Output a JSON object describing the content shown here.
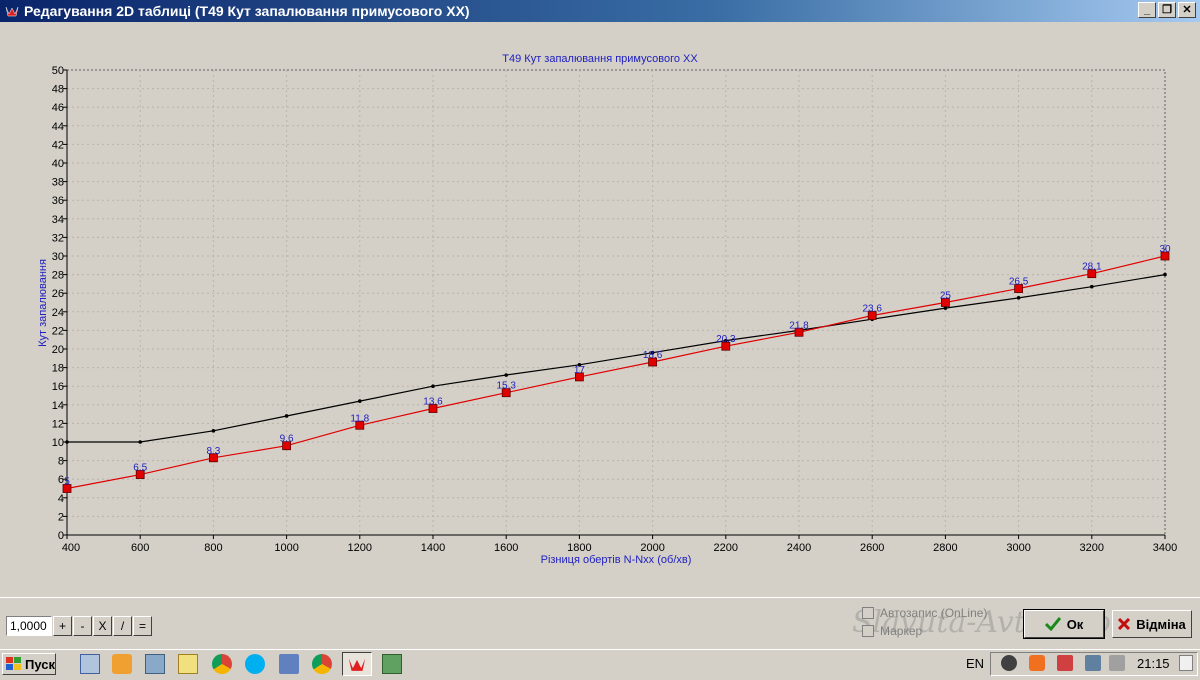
{
  "window": {
    "title": "Редагування 2D таблиці (T49 Кут запалювання примусового XX)",
    "buttons": {
      "minimize": "_",
      "restore": "❐",
      "close": "✕"
    }
  },
  "chart_data": {
    "type": "line",
    "title": "T49 Кут запалювання примусового XX",
    "xlabel": "Різниця обертів N-Nxx (об/хв)",
    "ylabel": "Кут запалювання",
    "x": [
      400,
      600,
      800,
      1000,
      1200,
      1400,
      1600,
      1800,
      2000,
      2200,
      2400,
      2600,
      2800,
      3000,
      3200,
      3400
    ],
    "xlim": [
      400,
      3400
    ],
    "ylim": [
      0,
      50
    ],
    "x_ticks": [
      400,
      600,
      800,
      1000,
      1200,
      1400,
      1600,
      1800,
      2000,
      2200,
      2400,
      2600,
      2800,
      3000,
      3200,
      3400
    ],
    "y_ticks": [
      0,
      2,
      4,
      6,
      8,
      10,
      12,
      14,
      16,
      18,
      20,
      22,
      24,
      26,
      28,
      30,
      32,
      34,
      36,
      38,
      40,
      42,
      44,
      46,
      48,
      50
    ],
    "grid": true,
    "series": [
      {
        "values": [
          5,
          6.5,
          8.3,
          9.6,
          11.8,
          13.6,
          15.3,
          17,
          18.6,
          20.3,
          21.8,
          23.6,
          25,
          26.5,
          28.1,
          30
        ],
        "color": "#e00000",
        "marker": "square",
        "labels": [
          "5",
          "6.5",
          "8.3",
          "9.6",
          "11.8",
          "13.6",
          "15.3",
          "17",
          "18.6",
          "20.3",
          "21.8",
          "23.6",
          "25",
          "26.5",
          "28.1",
          "30"
        ]
      },
      {
        "values": [
          10,
          10,
          11.2,
          12.8,
          14.4,
          16,
          17.2,
          18.3,
          19.6,
          20.9,
          22,
          23.2,
          24.4,
          25.5,
          26.7,
          28
        ],
        "color": "#000000",
        "marker": "dot"
      }
    ]
  },
  "calc": {
    "value": "1,0000",
    "ops": [
      "+",
      "-",
      "X",
      "/",
      "="
    ]
  },
  "options": {
    "autosave": "Автозапис (OnLine)",
    "marker": "Маркер"
  },
  "actions": {
    "ok": "Ок",
    "cancel": "Відміна"
  },
  "taskbar": {
    "start": "Пуск",
    "lang": "EN",
    "clock": "21:15"
  },
  "watermark": "Slavuta-Avto.info"
}
